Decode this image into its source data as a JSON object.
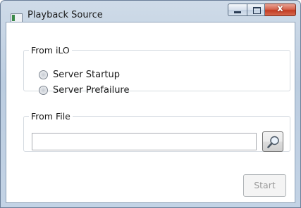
{
  "window": {
    "title": "Playback Source",
    "close_glyph": "x"
  },
  "from_ilo": {
    "label": "From iLO",
    "options": [
      {
        "label": "Server Startup",
        "selected": false
      },
      {
        "label": "Server Prefailure",
        "selected": false
      }
    ]
  },
  "from_file": {
    "label": "From File",
    "path_value": "",
    "browse_icon": "magnifier-icon"
  },
  "actions": {
    "start_label": "Start",
    "start_enabled": false
  }
}
